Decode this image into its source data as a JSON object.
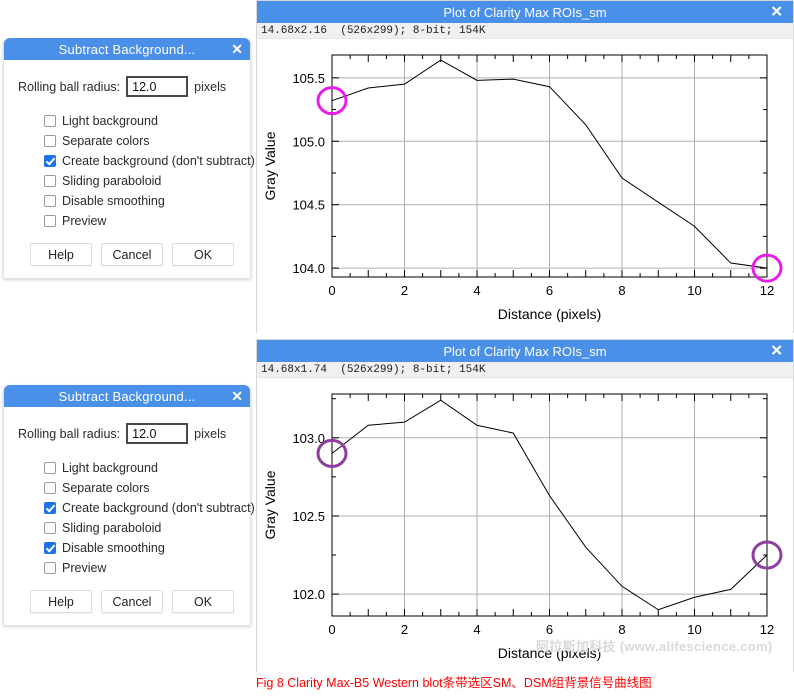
{
  "dialogs": [
    {
      "title": "Subtract Background...",
      "close_icon": "close-icon",
      "radius_label": "Rolling ball radius:",
      "radius_value": "12.0",
      "radius_unit": "pixels",
      "options": [
        {
          "label": "Light background",
          "checked": false
        },
        {
          "label": "Separate colors",
          "checked": false
        },
        {
          "label": "Create background (don't subtract)",
          "checked": true
        },
        {
          "label": "Sliding paraboloid",
          "checked": false
        },
        {
          "label": "Disable smoothing",
          "checked": false
        },
        {
          "label": "Preview",
          "checked": false
        }
      ],
      "buttons": [
        "Help",
        "Cancel",
        "OK"
      ]
    },
    {
      "title": "Subtract Background...",
      "close_icon": "close-icon",
      "radius_label": "Rolling ball radius:",
      "radius_value": "12.0",
      "radius_unit": "pixels",
      "options": [
        {
          "label": "Light background",
          "checked": false
        },
        {
          "label": "Separate colors",
          "checked": false
        },
        {
          "label": "Create background (don't subtract)",
          "checked": true
        },
        {
          "label": "Sliding paraboloid",
          "checked": false
        },
        {
          "label": "Disable smoothing",
          "checked": true
        },
        {
          "label": "Preview",
          "checked": false
        }
      ],
      "buttons": [
        "Help",
        "Cancel",
        "OK"
      ]
    }
  ],
  "plots": [
    {
      "title": "Plot of Clarity Max ROIs_sm",
      "close_icon": "close-icon",
      "info": "14.68x2.16  (526x299); 8-bit; 154K"
    },
    {
      "title": "Plot of Clarity Max ROIs_sm",
      "close_icon": "close-icon",
      "info": "14.68x1.74  (526x299); 8-bit; 154K"
    }
  ],
  "caption": "Fig 8 Clarity Max-B5 Western blot条带选区SM、DSM组背景信号曲线图",
  "watermark": "阿拉斯加科技 (www.alifescience.com)",
  "colors": {
    "titlebar": "#4a90e8",
    "checkbox_on": "#1a73e8",
    "marker_plot1": "#e81ee8",
    "marker_plot2": "#8e3f9e",
    "caption": "#ff0000",
    "line": "#000000",
    "grid": "#b0b0b0"
  },
  "chart_data": [
    {
      "type": "line",
      "title": "Plot of Clarity Max ROIs_sm",
      "xlabel": "Distance (pixels)",
      "ylabel": "Gray Value",
      "x": [
        0,
        1,
        2,
        3,
        4,
        5,
        6,
        7,
        8,
        9,
        10,
        11,
        12
      ],
      "values": [
        105.32,
        105.42,
        105.45,
        105.64,
        105.48,
        105.49,
        105.43,
        105.13,
        104.71,
        104.52,
        104.33,
        104.04,
        104.0
      ],
      "xlim": [
        0,
        12
      ],
      "ylim": [
        103.93,
        105.68
      ],
      "xticks": [
        0,
        2,
        4,
        6,
        8,
        10,
        12
      ],
      "xticklabels": [
        "0",
        "2",
        "4",
        "6",
        "8",
        "10",
        "12"
      ],
      "yticks": [
        104.0,
        104.5,
        105.0,
        105.5
      ],
      "yticklabels": [
        "104.0",
        "104.5",
        "105.0",
        "105.5"
      ],
      "grid": true,
      "legend": null,
      "annotations": [
        {
          "name": "start-marker",
          "shape": "ellipse",
          "x": 0,
          "y": 105.32,
          "color": "#e81ee8"
        },
        {
          "name": "end-marker",
          "shape": "ellipse",
          "x": 12,
          "y": 104.0,
          "color": "#e81ee8"
        }
      ]
    },
    {
      "type": "line",
      "title": "Plot of Clarity Max ROIs_sm",
      "xlabel": "Distance (pixels)",
      "ylabel": "Gray Value",
      "x": [
        0,
        1,
        2,
        3,
        4,
        5,
        6,
        7,
        8,
        9,
        10,
        11,
        12
      ],
      "values": [
        102.9,
        103.08,
        103.1,
        103.24,
        103.08,
        103.03,
        102.63,
        102.3,
        102.05,
        101.9,
        101.98,
        102.03,
        102.25
      ],
      "xlim": [
        0,
        12
      ],
      "ylim": [
        101.86,
        103.28
      ],
      "xticks": [
        0,
        2,
        4,
        6,
        8,
        10,
        12
      ],
      "xticklabels": [
        "0",
        "2",
        "4",
        "6",
        "8",
        "10",
        "12"
      ],
      "yticks": [
        102.0,
        102.5,
        103.0
      ],
      "yticklabels": [
        "102.0",
        "102.5",
        "103.0"
      ],
      "grid": true,
      "legend": null,
      "annotations": [
        {
          "name": "start-marker",
          "shape": "ellipse",
          "x": 0,
          "y": 102.9,
          "color": "#8e3f9e"
        },
        {
          "name": "end-marker",
          "shape": "ellipse",
          "x": 12,
          "y": 102.25,
          "color": "#8e3f9e"
        }
      ]
    }
  ]
}
